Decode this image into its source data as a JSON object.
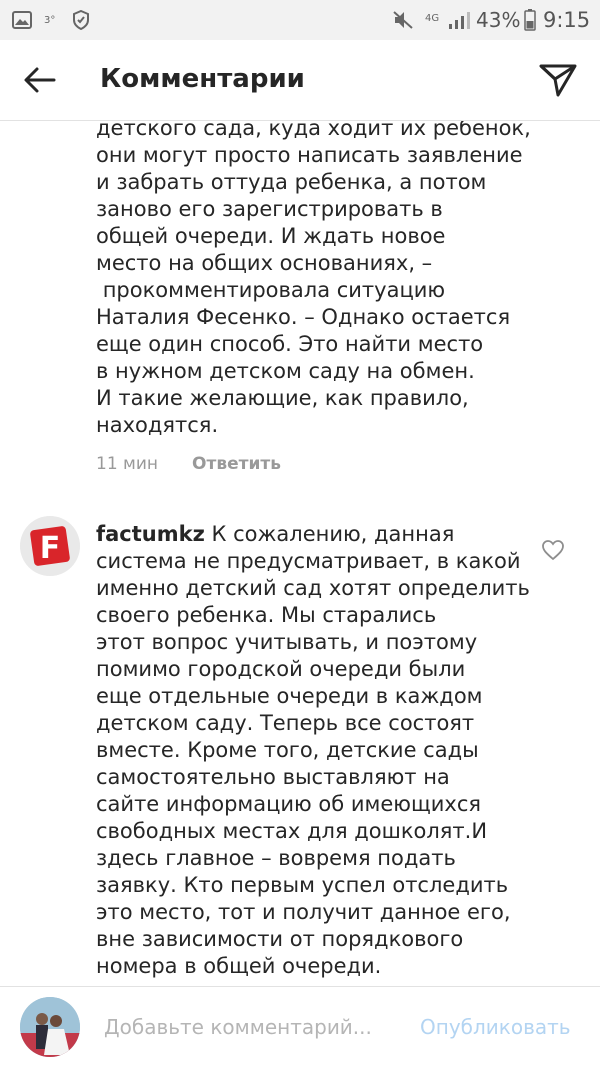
{
  "status_bar": {
    "temp": "3°",
    "network": "4G",
    "battery": "43%",
    "time": "9:15"
  },
  "header": {
    "title": "Комментарии"
  },
  "comment_tail": {
    "text": "детского сада, куда ходит их ребенок,\nони могут просто написать заявление\nи забрать оттуда ребенка, а потом\nзаново его зарегистрировать в\nобщей очереди. И ждать новое\nместо на общих основаниях, –\n прокомментировала ситуацию\nНаталия Фесенко. – Однако остается\nеще один способ. Это найти место\nв нужном детском саду на обмен.\nИ такие желающие, как правило,\nнаходятся.",
    "time": "11 мин",
    "reply": "Ответить"
  },
  "comment": {
    "username": "factumkz",
    "text": " К сожалению, данная\nсистема не предусматривает, в какой\nименно детский сад хотят определить\nсвоего ребенка. Мы старались\nэтот вопрос учитывать, и поэтому\nпомимо городской очереди были\nеще отдельные очереди в каждом\nдетском саду. Теперь все состоят\nвместе. Кроме того, детские сады\nсамостоятельно выставляют на\nсайте информацию об имеющихся\nсвободных местах для дошколят.И\nздесь главное – вовремя подать\nзаявку. Кто первым успел отследить\nэто место, тот и получит данное его,\nвне зависимости от порядкового\nномера в общей очереди.",
    "avatar_letter": "F"
  },
  "footer": {
    "placeholder": "Добавьте комментарий...",
    "publish": "Опубликовать"
  },
  "colors": {
    "accent_disabled": "#b3d4f2",
    "avatar_red": "#d9252a"
  }
}
